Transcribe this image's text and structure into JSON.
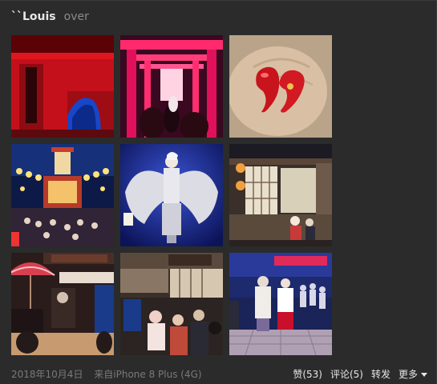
{
  "post": {
    "username": "``Louis",
    "status": "over",
    "date": "2018年10月4日",
    "source": "来自iPhone 8 Plus (4G)"
  },
  "actions": {
    "like": "赞(53)",
    "comment": "评论(5)",
    "share": "转发",
    "more": "更多"
  },
  "photos": [
    {
      "name": "photo-red-temple-gate"
    },
    {
      "name": "photo-red-torii-corridor"
    },
    {
      "name": "photo-red-magatama-in-hand"
    },
    {
      "name": "photo-festival-stage-lanterns"
    },
    {
      "name": "photo-winged-statue"
    },
    {
      "name": "photo-japanese-house-display"
    },
    {
      "name": "photo-umbrella-exhibit"
    },
    {
      "name": "photo-shop-street-crowd"
    },
    {
      "name": "photo-cosplay-crowd"
    }
  ],
  "colors": {
    "background": "#2b2b2b",
    "username": "#e6e6e6",
    "muted": "#7a7a7a"
  }
}
